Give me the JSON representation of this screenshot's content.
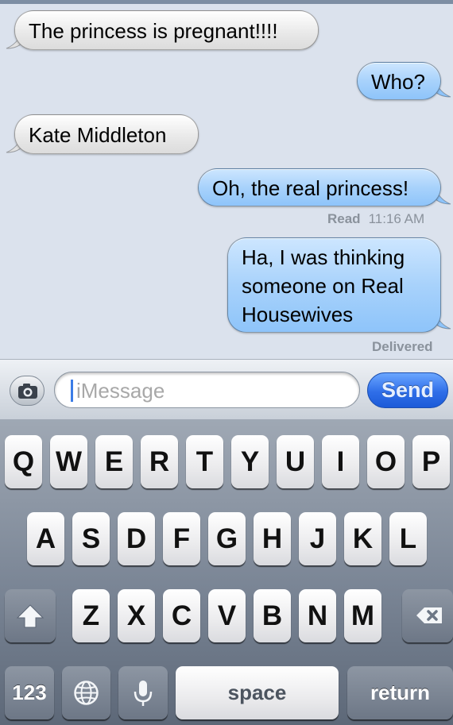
{
  "messages": [
    {
      "direction": "incoming",
      "text": "The princess is pregnant!!!!"
    },
    {
      "direction": "outgoing",
      "text": "Who?"
    },
    {
      "direction": "incoming",
      "text": "Kate Middleton"
    },
    {
      "direction": "outgoing",
      "text": "Oh, the real princess!"
    },
    {
      "direction": "outgoing",
      "text": "Ha, I was thinking\nsomeone on Real\nHousewives"
    }
  ],
  "receipts": {
    "read_label": "Read",
    "read_time": "11:16 AM",
    "delivered_label": "Delivered"
  },
  "composer": {
    "placeholder": "iMessage",
    "send_label": "Send",
    "camera_icon": "camera-icon"
  },
  "keyboard": {
    "row1": [
      "Q",
      "W",
      "E",
      "R",
      "T",
      "Y",
      "U",
      "I",
      "O",
      "P"
    ],
    "row2": [
      "A",
      "S",
      "D",
      "F",
      "G",
      "H",
      "J",
      "K",
      "L"
    ],
    "row3": [
      "Z",
      "X",
      "C",
      "V",
      "B",
      "N",
      "M"
    ],
    "numbers_label": "123",
    "space_label": "space",
    "return_label": "return",
    "icons": [
      "shift-icon",
      "backspace-icon",
      "globe-icon",
      "microphone-icon"
    ]
  },
  "colors": {
    "thread_bg": "#dbe2ed",
    "outgoing_bubble": "#a8d2fb",
    "incoming_bubble": "#ececec",
    "send_button": "#2f6ee8"
  }
}
